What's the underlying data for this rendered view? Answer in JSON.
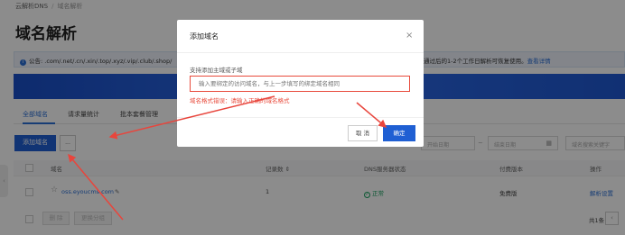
{
  "breadcrumb": {
    "parent": "云解析DNS",
    "separator": "/",
    "current": "域名解析"
  },
  "page_title": "域名解析",
  "notice": {
    "icon": "info-icon",
    "text": "公告: .com/.net/.cn/.xin/.top/.xyz/.vip/.club/.shop/",
    "tail": "审核通过后的1-2个工作日解析可恢复使用。",
    "link": "查看详情"
  },
  "tabs": [
    {
      "label": "全部域名",
      "active": true
    },
    {
      "label": "请求量统计",
      "active": false
    },
    {
      "label": "批本套餐管理",
      "active": false
    }
  ],
  "toolbar": {
    "add_label": "添加域名",
    "more_label": "..."
  },
  "filters": {
    "start_date": "开始日期",
    "dash": "~",
    "end_date": "结束日期",
    "keyword": "域名搜索关键字"
  },
  "table": {
    "headers": {
      "domain": "域名",
      "records": "记录数 ⇕",
      "dns_status": "DNS服务器状态",
      "edition": "付费版本",
      "actions": "操作"
    },
    "rows": [
      {
        "domain": "oss.eyoucms.com",
        "records": "1",
        "status": "正常",
        "edition": "免费版",
        "action": "解析设置"
      }
    ]
  },
  "footer": {
    "delete_label": "删 除",
    "group_label": "更换分组",
    "total": "共1条"
  },
  "modal": {
    "title": "添加域名",
    "close": "×",
    "field_label": "支持添加主域或子域",
    "input_placeholder": "输入要绑定的访问域名，与上一步填写的绑定域名相同",
    "error": "域名格式错误：请输入正确的域名格式",
    "cancel": "取 消",
    "confirm": "确定"
  },
  "colors": {
    "accent": "#1f5fd3",
    "error": "#e84b3c",
    "success": "#19a15f",
    "arrow": "#e8453c"
  }
}
